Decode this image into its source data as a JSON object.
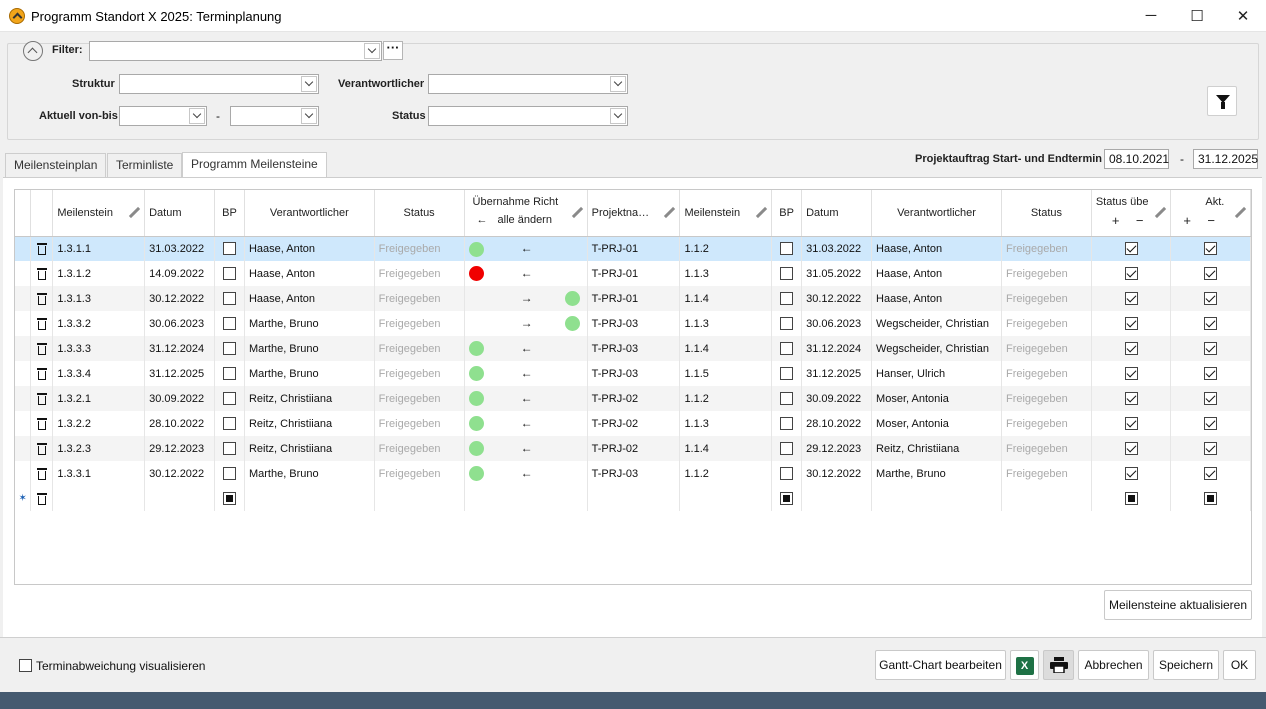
{
  "window": {
    "title": "Programm Standort X 2025: Terminplanung",
    "minimize_icon": "─",
    "maximize_icon": "☐",
    "close_icon": "✕"
  },
  "filter": {
    "filter_label": "Filter:",
    "ellipsis_label": "···",
    "struktur_label": "Struktur",
    "verantwortlicher_label": "Verantwortlicher",
    "aktuell_label": "Aktuell von-bis",
    "dash": "-",
    "status_label": "Status"
  },
  "tabs": [
    "Meilensteinplan",
    "Terminliste",
    "Programm Meilensteine"
  ],
  "project": {
    "label": "Projektauftrag Start- und Endtermin",
    "start": "08.10.2021",
    "dash": "-",
    "end": "31.12.2025"
  },
  "grid": {
    "headers": {
      "meilenstein": "Meilenstein",
      "datum": "Datum",
      "bp": "BP",
      "verantwortlicher": "Verantwortlicher",
      "status": "Status",
      "uebernahme": "Übernahme Richt",
      "uebernahme_arrow": "←",
      "alle_aendern": "alle ändern",
      "projektname": "Projektna…",
      "meilenstein2": "Meilenstein",
      "bp2": "BP",
      "datum2": "Datum",
      "verantwortlicher2": "Verantwortlicher",
      "status2": "Status",
      "status_ueber": "Status übe",
      "akt": "Akt.",
      "plus": "+",
      "minus": "−"
    },
    "rows": [
      {
        "ms": "1.3.1.1",
        "datum": "31.03.2022",
        "verantw": "Haase, Anton",
        "status": "Freigegeben",
        "dot": "green",
        "dot_side": "left",
        "arrow": "←",
        "proj": "T-PRJ-01",
        "ms2": "1.1.2",
        "datum2": "31.03.2022",
        "verantw2": "Haase, Anton",
        "status2": "Freigegeben"
      },
      {
        "ms": "1.3.1.2",
        "datum": "14.09.2022",
        "verantw": "Haase, Anton",
        "status": "Freigegeben",
        "dot": "red",
        "dot_side": "left",
        "arrow": "←",
        "proj": "T-PRJ-01",
        "ms2": "1.1.3",
        "datum2": "31.05.2022",
        "verantw2": "Haase, Anton",
        "status2": "Freigegeben"
      },
      {
        "ms": "1.3.1.3",
        "datum": "30.12.2022",
        "verantw": "Haase, Anton",
        "status": "Freigegeben",
        "dot": "green",
        "dot_side": "right",
        "arrow": "→",
        "proj": "T-PRJ-01",
        "ms2": "1.1.4",
        "datum2": "30.12.2022",
        "verantw2": "Haase, Anton",
        "status2": "Freigegeben"
      },
      {
        "ms": "1.3.3.2",
        "datum": "30.06.2023",
        "verantw": "Marthe, Bruno",
        "status": "Freigegeben",
        "dot": "green",
        "dot_side": "right",
        "arrow": "→",
        "proj": "T-PRJ-03",
        "ms2": "1.1.3",
        "datum2": "30.06.2023",
        "verantw2": "Wegscheider, Christian",
        "status2": "Freigegeben"
      },
      {
        "ms": "1.3.3.3",
        "datum": "31.12.2024",
        "verantw": "Marthe, Bruno",
        "status": "Freigegeben",
        "dot": "green",
        "dot_side": "left",
        "arrow": "←",
        "proj": "T-PRJ-03",
        "ms2": "1.1.4",
        "datum2": "31.12.2024",
        "verantw2": "Wegscheider, Christian",
        "status2": "Freigegeben"
      },
      {
        "ms": "1.3.3.4",
        "datum": "31.12.2025",
        "verantw": "Marthe, Bruno",
        "status": "Freigegeben",
        "dot": "green",
        "dot_side": "left",
        "arrow": "←",
        "proj": "T-PRJ-03",
        "ms2": "1.1.5",
        "datum2": "31.12.2025",
        "verantw2": "Hanser, Ulrich",
        "status2": "Freigegeben"
      },
      {
        "ms": "1.3.2.1",
        "datum": "30.09.2022",
        "verantw": "Reitz, Christiiana",
        "status": "Freigegeben",
        "dot": "green",
        "dot_side": "left",
        "arrow": "←",
        "proj": "T-PRJ-02",
        "ms2": "1.1.2",
        "datum2": "30.09.2022",
        "verantw2": "Moser, Antonia",
        "status2": "Freigegeben"
      },
      {
        "ms": "1.3.2.2",
        "datum": "28.10.2022",
        "verantw": "Reitz, Christiiana",
        "status": "Freigegeben",
        "dot": "green",
        "dot_side": "left",
        "arrow": "←",
        "proj": "T-PRJ-02",
        "ms2": "1.1.3",
        "datum2": "28.10.2022",
        "verantw2": "Moser, Antonia",
        "status2": "Freigegeben"
      },
      {
        "ms": "1.3.2.3",
        "datum": "29.12.2023",
        "verantw": "Reitz, Christiiana",
        "status": "Freigegeben",
        "dot": "green",
        "dot_side": "left",
        "arrow": "←",
        "proj": "T-PRJ-02",
        "ms2": "1.1.4",
        "datum2": "29.12.2023",
        "verantw2": "Reitz, Christiiana",
        "status2": "Freigegeben"
      },
      {
        "ms": "1.3.3.1",
        "datum": "30.12.2022",
        "verantw": "Marthe, Bruno",
        "status": "Freigegeben",
        "dot": "green",
        "dot_side": "left",
        "arrow": "←",
        "proj": "T-PRJ-03",
        "ms2": "1.1.2",
        "datum2": "30.12.2022",
        "verantw2": "Marthe, Bruno",
        "status2": "Freigegeben"
      }
    ],
    "new_row_marker": "✶"
  },
  "buttons": {
    "meilensteine_aktualisieren": "Meilensteine aktualisieren",
    "terminabweichung": "Terminabweichung visualisieren",
    "gantt": "Gantt-Chart bearbeiten",
    "excel_icon_text": "X",
    "abbrechen": "Abbrechen",
    "speichern": "Speichern",
    "ok": "OK"
  },
  "colors": {
    "green_dot": "#8fe08f",
    "red_dot": "#f00000",
    "selected_row": "#cfe8fc",
    "status_bar": "#455a70",
    "excel_green": "#1e7145"
  }
}
